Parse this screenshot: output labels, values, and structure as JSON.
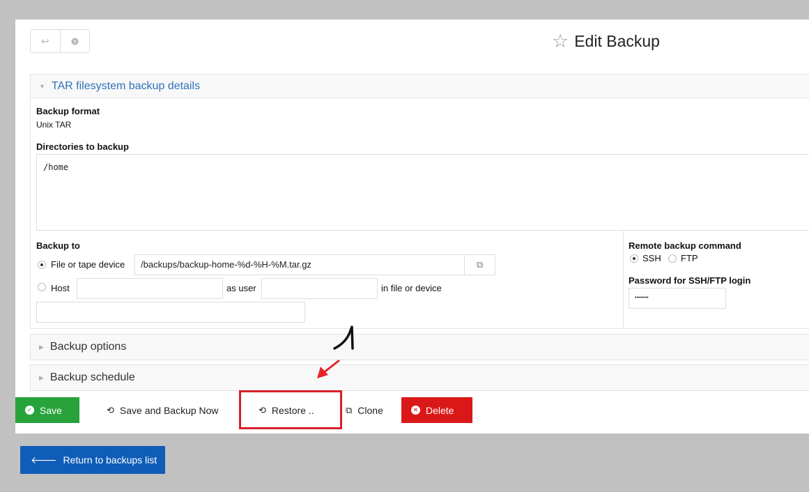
{
  "toolbar": {
    "back_icon": "return-arrow",
    "help_icon": "question-circle",
    "star_icon": "star-outline",
    "title": "Edit Backup"
  },
  "details": {
    "heading": "TAR filesystem backup details",
    "format_label": "Backup format",
    "format_value": "Unix TAR",
    "dirs_label": "Directories to backup",
    "dirs_value": "/home",
    "backup_to_label": "Backup to",
    "file_option_label": "File or tape device",
    "file_path_value": "/backups/backup-home-%d-%H-%M.tar.gz",
    "host_option_label": "Host",
    "host_value": "",
    "as_user_label": "as user",
    "user_value": "",
    "in_file_label": "in file or device",
    "remote_file_value": "",
    "remote_cmd_label": "Remote backup command",
    "ssh_label": "SSH",
    "ftp_label": "FTP",
    "password_label": "Password for SSH/FTP login",
    "password_value": "••••••••"
  },
  "sections": {
    "options": "Backup options",
    "schedule": "Backup schedule"
  },
  "actions": {
    "save": "Save",
    "save_backup_now": "Save and Backup Now",
    "restore": "Restore ..",
    "clone": "Clone",
    "delete": "Delete"
  },
  "footer": {
    "return_label": "Return to backups list"
  },
  "colors": {
    "save": "#28a33c",
    "delete": "#db1818",
    "return": "#0f5db8",
    "annotation": "#d81f26"
  }
}
